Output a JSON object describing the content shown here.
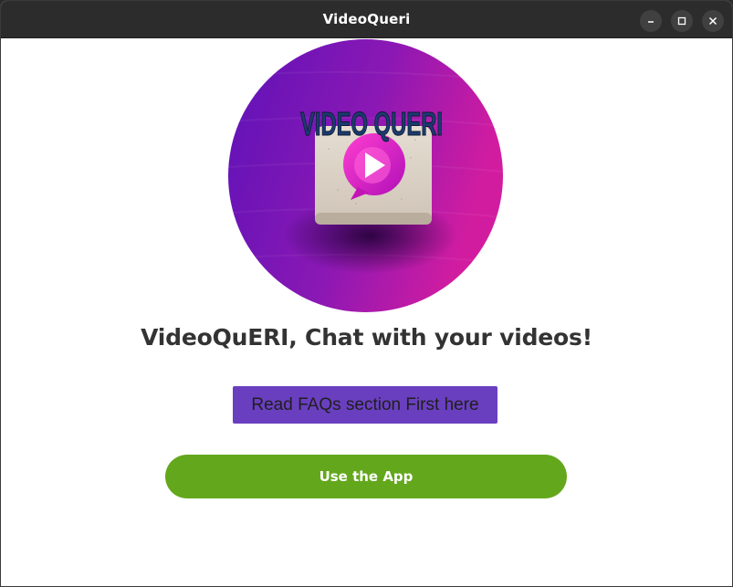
{
  "window": {
    "title": "VideoQueri",
    "controls": {
      "minimize_icon": "minimize-icon",
      "maximize_icon": "maximize-icon",
      "close_icon": "close-icon"
    }
  },
  "logo": {
    "text": "VIDEO QUERI",
    "icon": "play-chat-bubble-icon",
    "colors": {
      "gradient_left": "#5e12b8",
      "gradient_right": "#d21ca0",
      "tile": "#d8cfc4",
      "text": "#1b3b6f"
    }
  },
  "main": {
    "headline": "VideoQuERI, Chat with your videos!",
    "faq_button_label": "Read FAQs section First here",
    "use_button_label": "Use the App"
  },
  "colors": {
    "titlebar": "#2c2c2c",
    "faq_button": "#6a3fbf",
    "use_button": "#63a81c",
    "headline": "#333333"
  }
}
